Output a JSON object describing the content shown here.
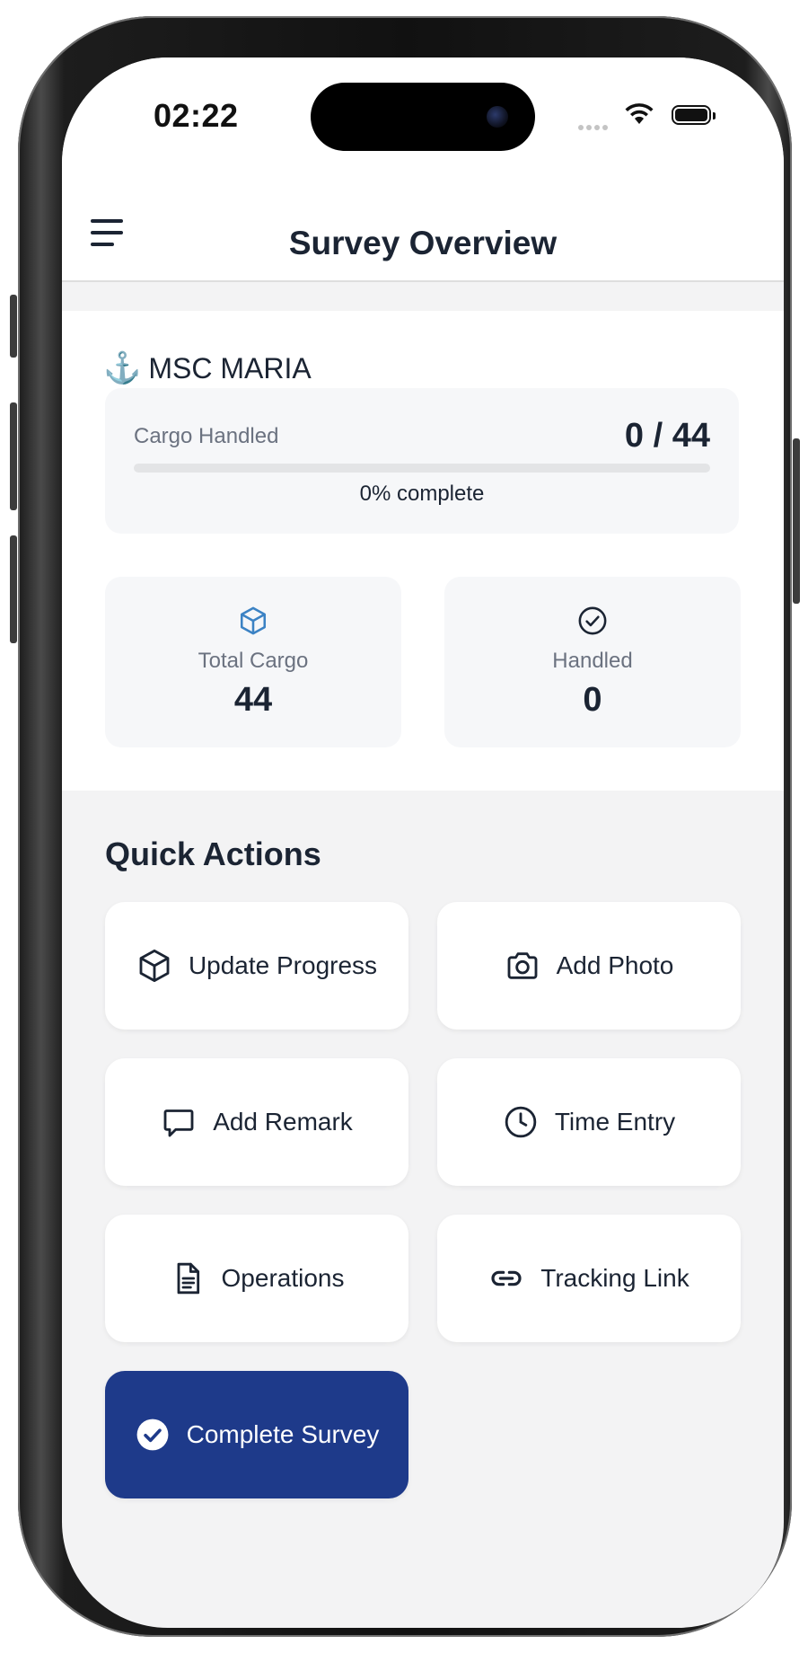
{
  "status_bar": {
    "time": "02:22"
  },
  "header": {
    "title": "Survey Overview",
    "menu_icon": "hamburger-menu-icon"
  },
  "vessel": {
    "icon": "anchor-icon",
    "name": "MSC MARIA"
  },
  "progress": {
    "label": "Cargo Handled",
    "count_text": "0 / 44",
    "percent_text": "0% complete",
    "fraction": 0
  },
  "stats": [
    {
      "icon": "cube-icon",
      "label": "Total Cargo",
      "value": "44",
      "icon_color": "#3b82c4"
    },
    {
      "icon": "check-circle-icon",
      "label": "Handled",
      "value": "0",
      "icon_color": "#1b2433"
    }
  ],
  "quick_actions": {
    "title": "Quick Actions",
    "items": [
      {
        "label": "Update Progress",
        "icon": "cube-icon"
      },
      {
        "label": "Add Photo",
        "icon": "camera-icon"
      },
      {
        "label": "Add Remark",
        "icon": "chat-bubble-icon"
      },
      {
        "label": "Time Entry",
        "icon": "clock-icon"
      },
      {
        "label": "Operations",
        "icon": "document-icon"
      },
      {
        "label": "Tracking Link",
        "icon": "link-icon"
      },
      {
        "label": "Complete Survey",
        "icon": "check-circle-icon",
        "primary": true
      }
    ]
  },
  "colors": {
    "primary": "#1e3a8a",
    "text": "#1b2433",
    "muted": "#6b7280",
    "accent": "#3b82c4"
  }
}
